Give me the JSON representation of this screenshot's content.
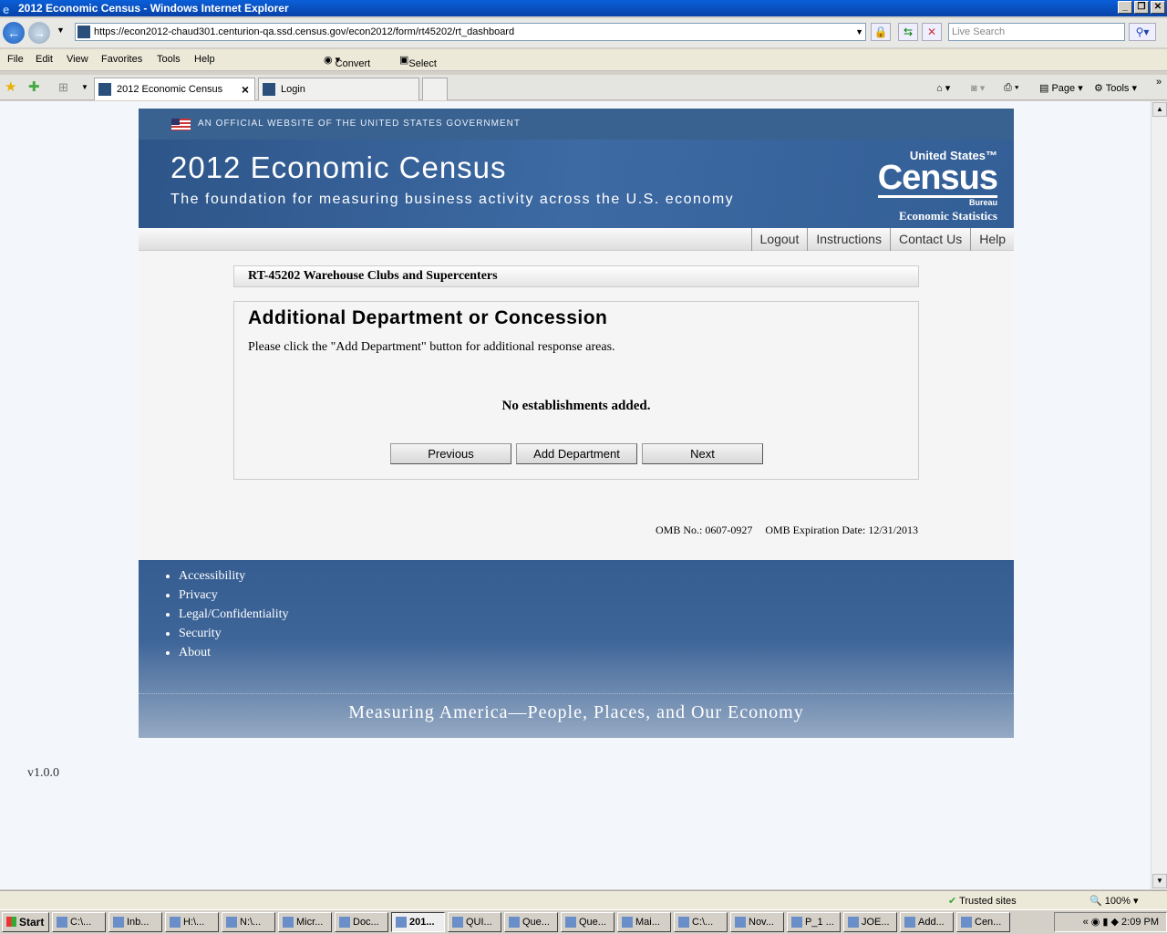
{
  "window": {
    "title": "2012 Economic Census - Windows Internet Explorer"
  },
  "browser": {
    "url": "https://econ2012-chaud301.centurion-qa.ssd.census.gov/econ2012/form/rt45202/rt_dashboard",
    "search_placeholder": "Live Search",
    "menu": [
      "File",
      "Edit",
      "View",
      "Favorites",
      "Tools",
      "Help"
    ],
    "convert": "Convert",
    "select": "Select",
    "tabs": [
      {
        "label": "2012 Economic Census",
        "close": "×"
      },
      {
        "label": "Login"
      }
    ],
    "commands": {
      "page": "Page",
      "tools": "Tools"
    },
    "status": {
      "zone": "Trusted sites",
      "zoom": "100%"
    }
  },
  "site": {
    "gov_banner": "AN OFFICIAL WEBSITE OF THE UNITED STATES GOVERNMENT",
    "title": "2012 Economic Census",
    "subtitle": "The foundation for measuring business activity across the U.S. economy",
    "logo": {
      "line1": "United States™",
      "line2": "Census",
      "line3": "Bureau",
      "line4": "Economic Statistics"
    },
    "nav": [
      "Logout",
      "Instructions",
      "Contact Us",
      "Help"
    ]
  },
  "main": {
    "survey": "RT-45202 Warehouse Clubs and Supercenters",
    "heading": "Additional Department or Concession",
    "instruction": "Please click the \"Add Department\" button for additional response areas.",
    "empty": "No establishments added.",
    "buttons": {
      "previous": "Previous",
      "add": "Add Department",
      "next": "Next"
    },
    "omb_no": "OMB No.: 0607-0927",
    "omb_exp": "OMB Expiration Date: 12/31/2013"
  },
  "footer": {
    "links": [
      "Accessibility",
      "Privacy",
      "Legal/Confidentiality",
      "Security",
      "About"
    ],
    "tagline": "Measuring America—People, Places, and Our Economy"
  },
  "version": "v1.0.0",
  "taskbar": {
    "start": "Start",
    "items": [
      "C:\\...",
      "Inb...",
      "H:\\...",
      "N:\\...",
      "Micr...",
      "Doc...",
      "201...",
      "QUI...",
      "Que...",
      "Que...",
      "Mai...",
      "C:\\...",
      "Nov...",
      "P_1 ...",
      "JOE...",
      "Add...",
      "Cen..."
    ],
    "clock": "2:09 PM"
  }
}
